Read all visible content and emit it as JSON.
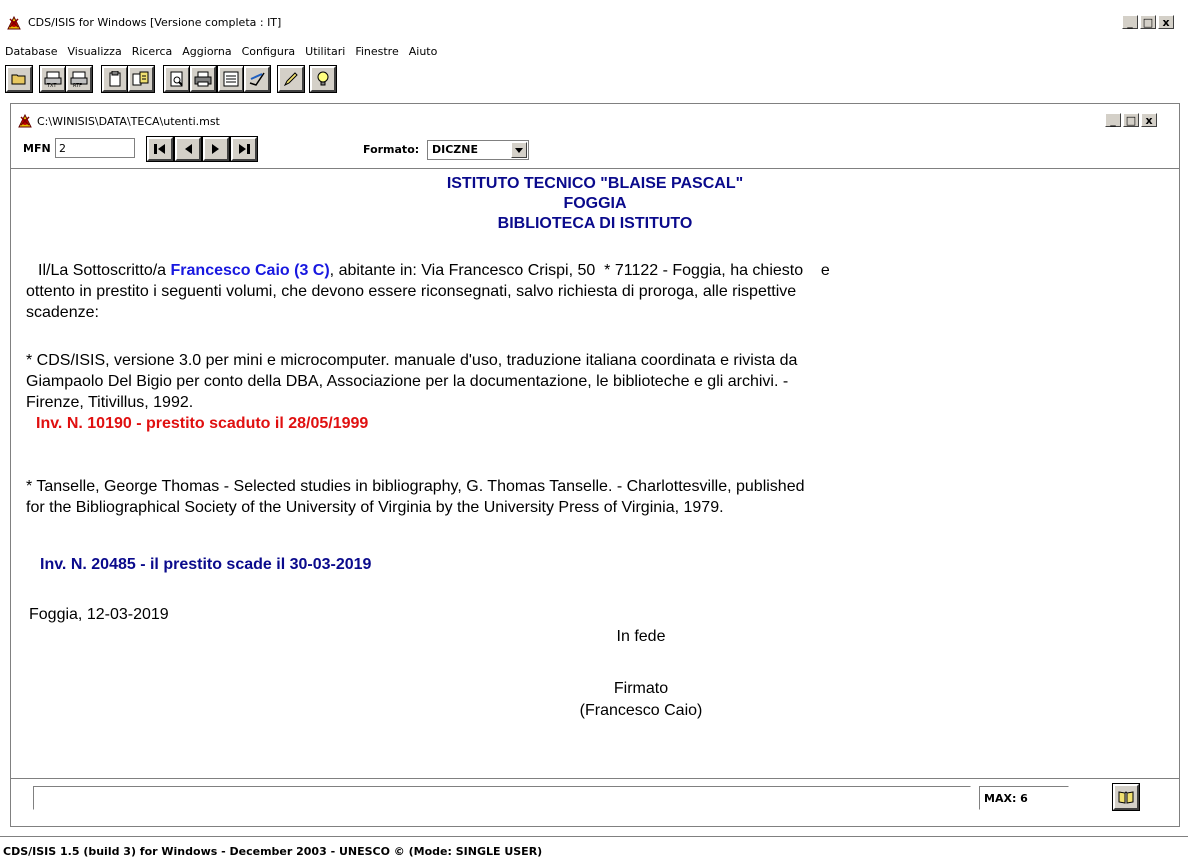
{
  "app": {
    "title": "CDS/ISIS for Windows [Versione completa : IT]",
    "menu": [
      "Database",
      "Visualizza",
      "Ricerca",
      "Aggiorna",
      "Configura",
      "Utilitari",
      "Finestre",
      "Aiuto"
    ],
    "toolbar_icons": [
      "open-folder-icon",
      "print-txt-icon",
      "print-rtf-icon",
      "clipboard-icon",
      "copy-record-icon",
      "preview-icon",
      "print-icon",
      "form-icon",
      "edit-check-icon",
      "pencil-icon",
      "lightbulb-icon"
    ],
    "footer": "CDS/ISIS 1.5 (build 3) for Windows - December 2003 - UNESCO © (Mode: SINGLE USER)"
  },
  "window": {
    "title": "C:\\WINISIS\\DATA\\TECA\\utenti.mst",
    "mfn_label": "MFN",
    "mfn_value": "2",
    "formato_label": "Formato:",
    "formato_value": "DICZNE",
    "max_label": "MAX: 6"
  },
  "document": {
    "header1": "ISTITUTO TECNICO  \"BLAISE PASCAL\"",
    "header2": "FOGGIA",
    "header3": "BIBLIOTECA DI ISTITUTO",
    "intro_pre": "Il/La Sottoscritto/a ",
    "borrower": "Francesco Caio (3 C)",
    "intro_line1_post": ", abitante in: Via Francesco Crispi, 50  * 71122 - Foggia, ha chiesto    e",
    "intro_line2": "ottento in prestito i seguenti volumi, che devono essere riconsegnati, salvo richiesta di proroga, alle   rispettive",
    "intro_line3": "scadenze:",
    "book1_line1": " * CDS/ISIS, versione 3.0 per mini e microcomputer. manuale d'uso, traduzione italiana coordinata e rivista  da",
    "book1_line2": "Giampaolo Del Bigio per conto della DBA, Associazione per la documentazione, le biblioteche e gli archivi.  -",
    "book1_line3": "Firenze, Titivillus, 1992.",
    "book1_inv": "Inv. N. 10190 - prestito scaduto il  28/05/1999",
    "book2_line1": " * Tanselle, George Thomas - Selected studies in bibliography, G. Thomas Tanselle.  - Charlottesville,   published",
    "book2_line2": "for the Bibliographical Society of the University of Virginia by the University Press of Virginia, 1979.",
    "book2_inv": "Inv. N. 20485 - il prestito  scade il  30-03-2019",
    "place_date": "Foggia, 12-03-2019",
    "in_fede": "In fede",
    "firmato": "Firmato",
    "signature_name": "(Francesco Caio)"
  }
}
